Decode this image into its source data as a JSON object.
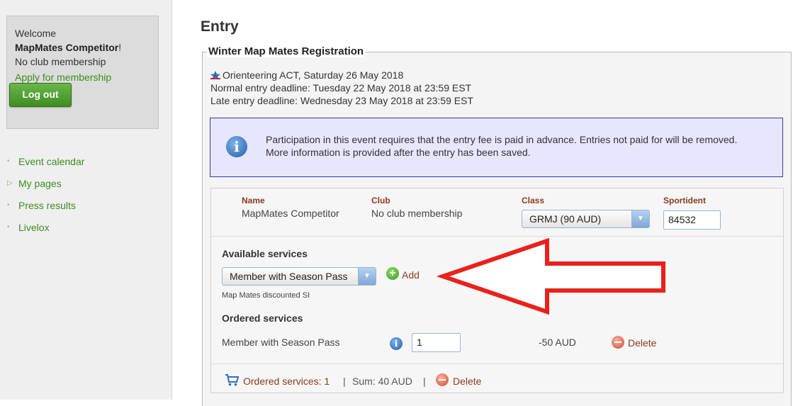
{
  "sidebar": {
    "welcome_label": "Welcome",
    "user_name": "MapMates Competitor",
    "exclamation": "!",
    "club_status": "No club membership",
    "apply_link": "Apply for membership",
    "logout_label": "Log out",
    "nav": [
      {
        "label": "Event calendar",
        "marker": "•"
      },
      {
        "label": "My pages",
        "marker": "▷"
      },
      {
        "label": "Press results",
        "marker": "•"
      },
      {
        "label": "Livelox",
        "marker": "•"
      }
    ]
  },
  "main": {
    "title": "Entry",
    "legend": "Winter Map Mates Registration",
    "event_line": "Orienteering ACT, Saturday 26 May 2018",
    "normal_deadline": "Normal entry deadline: Tuesday 22 May 2018 at 23:59 EST",
    "late_deadline": "Late entry deadline: Wednesday 23 May 2018 at 23:59 EST",
    "info_line1": "Participation in this event requires that the entry fee is paid in advance. Entries not paid for will be removed.",
    "info_line2": "More information is provided after the entry has been saved."
  },
  "entry": {
    "headers": {
      "name": "Name",
      "club": "Club",
      "class": "Class",
      "sportident": "Sportident"
    },
    "name": "MapMates Competitor",
    "club": "No club membership",
    "class_selected": "GRMJ (90 AUD)",
    "sportident_value": "84532"
  },
  "services": {
    "available_title": "Available services",
    "service_selected": "Member with Season Pass",
    "add_label": "Add",
    "service_desc": "Map Mates discounted SI",
    "ordered_title": "Ordered services",
    "ordered_item": "Member with Season Pass",
    "quantity": "1",
    "price": "-50 AUD",
    "delete_label": "Delete"
  },
  "footer": {
    "ordered_count": "Ordered services: 1",
    "separator1": "|",
    "sum": "Sum: 40 AUD",
    "separator2": "|",
    "delete_label": "Delete"
  },
  "colors": {
    "link_green": "#3d8c1e",
    "link_brown": "#8b3a1f",
    "annotation_red": "#e8211c",
    "info_bg": "#e6e6ff"
  }
}
